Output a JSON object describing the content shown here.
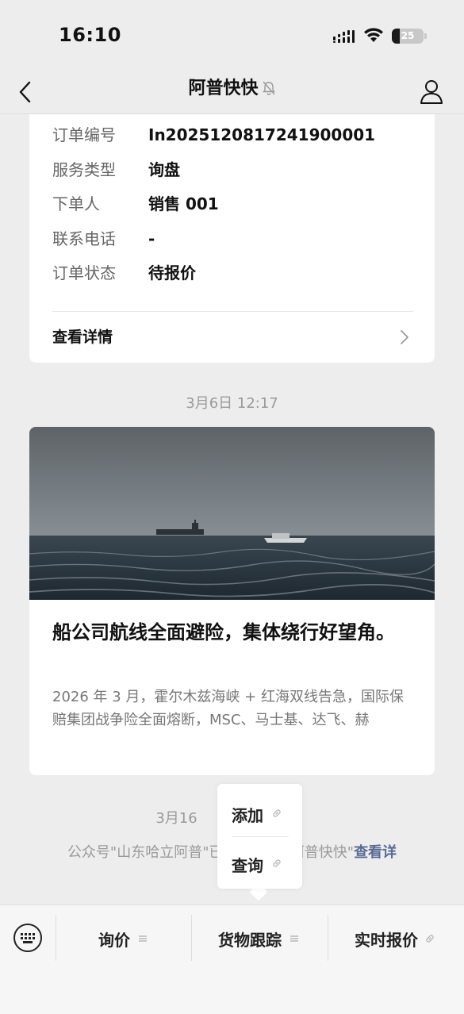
{
  "status_bar": {
    "time": "16:10",
    "battery_level": "25",
    "battery_fraction": 0.25
  },
  "nav": {
    "title": "阿普快快",
    "icons": [
      "back-chevron-icon",
      "mute-bell-icon",
      "profile-icon"
    ]
  },
  "order": {
    "rows": [
      {
        "label": "订单编号",
        "value": "In2025120817241900001"
      },
      {
        "label": "服务类型",
        "value": "询盘"
      },
      {
        "label": "下单人",
        "value": "销售 001"
      },
      {
        "label": "联系电话",
        "value": "-"
      },
      {
        "label": "订单状态",
        "value": "待报价"
      }
    ],
    "details_label": "查看详情"
  },
  "timestamps": {
    "article": "3月6日 12:17",
    "notice": "3月16"
  },
  "article": {
    "title": "船公司航线全面避险，集体绕行好望角。",
    "summary": "2026 年 3 月，霍尔木兹海峡 + 红海双线告急，国际保赔集团战争险全面熔断，MSC、马士基、达飞、赫"
  },
  "notice": {
    "text": "公众号\"山东哈立阿普\"已",
    "text_tail": "\"阿普快快\"",
    "link": "查看详"
  },
  "popup_menu": {
    "items": [
      {
        "label": "添加",
        "icon": "link-icon"
      },
      {
        "label": "查询",
        "icon": "link-icon"
      }
    ]
  },
  "bottom_menu": {
    "keyboard_icon": "keyboard-icon",
    "items": [
      {
        "label": "询价",
        "icon": "menu-lines-icon"
      },
      {
        "label": "货物跟踪",
        "icon": "menu-lines-icon"
      },
      {
        "label": "实时报价",
        "icon": "link-icon"
      }
    ]
  },
  "colors": {
    "background": "#ededed",
    "card": "#ffffff",
    "link": "#576b95",
    "muted_text": "#9a9a9a"
  }
}
